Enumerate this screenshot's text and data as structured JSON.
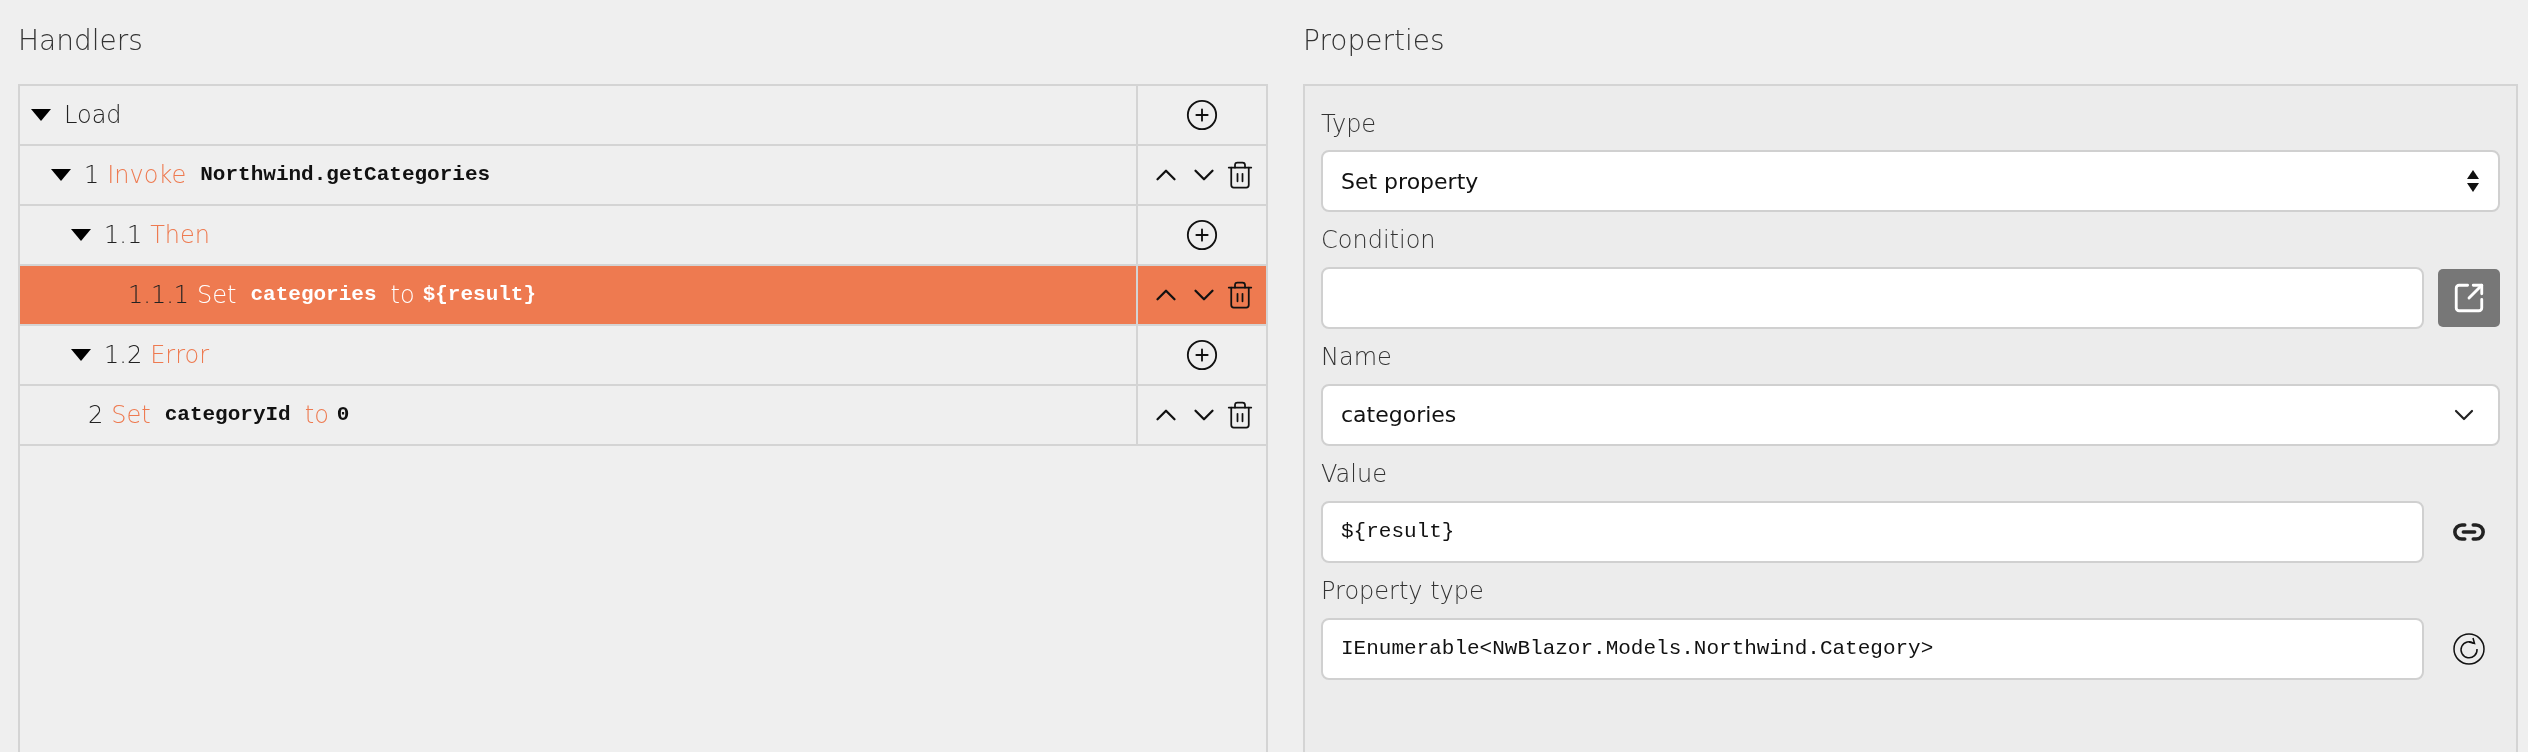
{
  "handlers": {
    "title": "Handlers",
    "tree": [
      {
        "kind": "event",
        "label": "Load",
        "expanded": true,
        "selected": false,
        "children": [
          {
            "kind": "action",
            "number": "1",
            "verb": "Invoke",
            "target": "Northwind.getCategories",
            "expanded": true,
            "selected": false,
            "children": [
              {
                "kind": "branch",
                "number": "1.1",
                "verb": "Then",
                "expanded": true,
                "selected": false,
                "children": [
                  {
                    "kind": "action",
                    "number": "1.1.1",
                    "verb": "Set",
                    "target": "categories",
                    "connector": "to",
                    "value": "${result}",
                    "selected": true
                  }
                ]
              },
              {
                "kind": "branch",
                "number": "1.2",
                "verb": "Error",
                "expanded": true,
                "selected": false
              }
            ]
          },
          {
            "kind": "action",
            "number": "2",
            "verb": "Set",
            "target": "categoryId",
            "connector": "to",
            "value": "0",
            "selected": false
          }
        ]
      }
    ]
  },
  "properties": {
    "title": "Properties",
    "fields": [
      {
        "kind": "select",
        "label": "Type",
        "value": "Set property"
      },
      {
        "kind": "condition",
        "label": "Condition"
      },
      {
        "kind": "dropdown",
        "label": "Name",
        "value": "categories"
      },
      {
        "kind": "bound",
        "label": "Value",
        "value": "${result}"
      },
      {
        "kind": "typed",
        "label": "Property type",
        "value": "IEnumerable<NwBlazor.Models.Northwind.Category>"
      }
    ]
  }
}
